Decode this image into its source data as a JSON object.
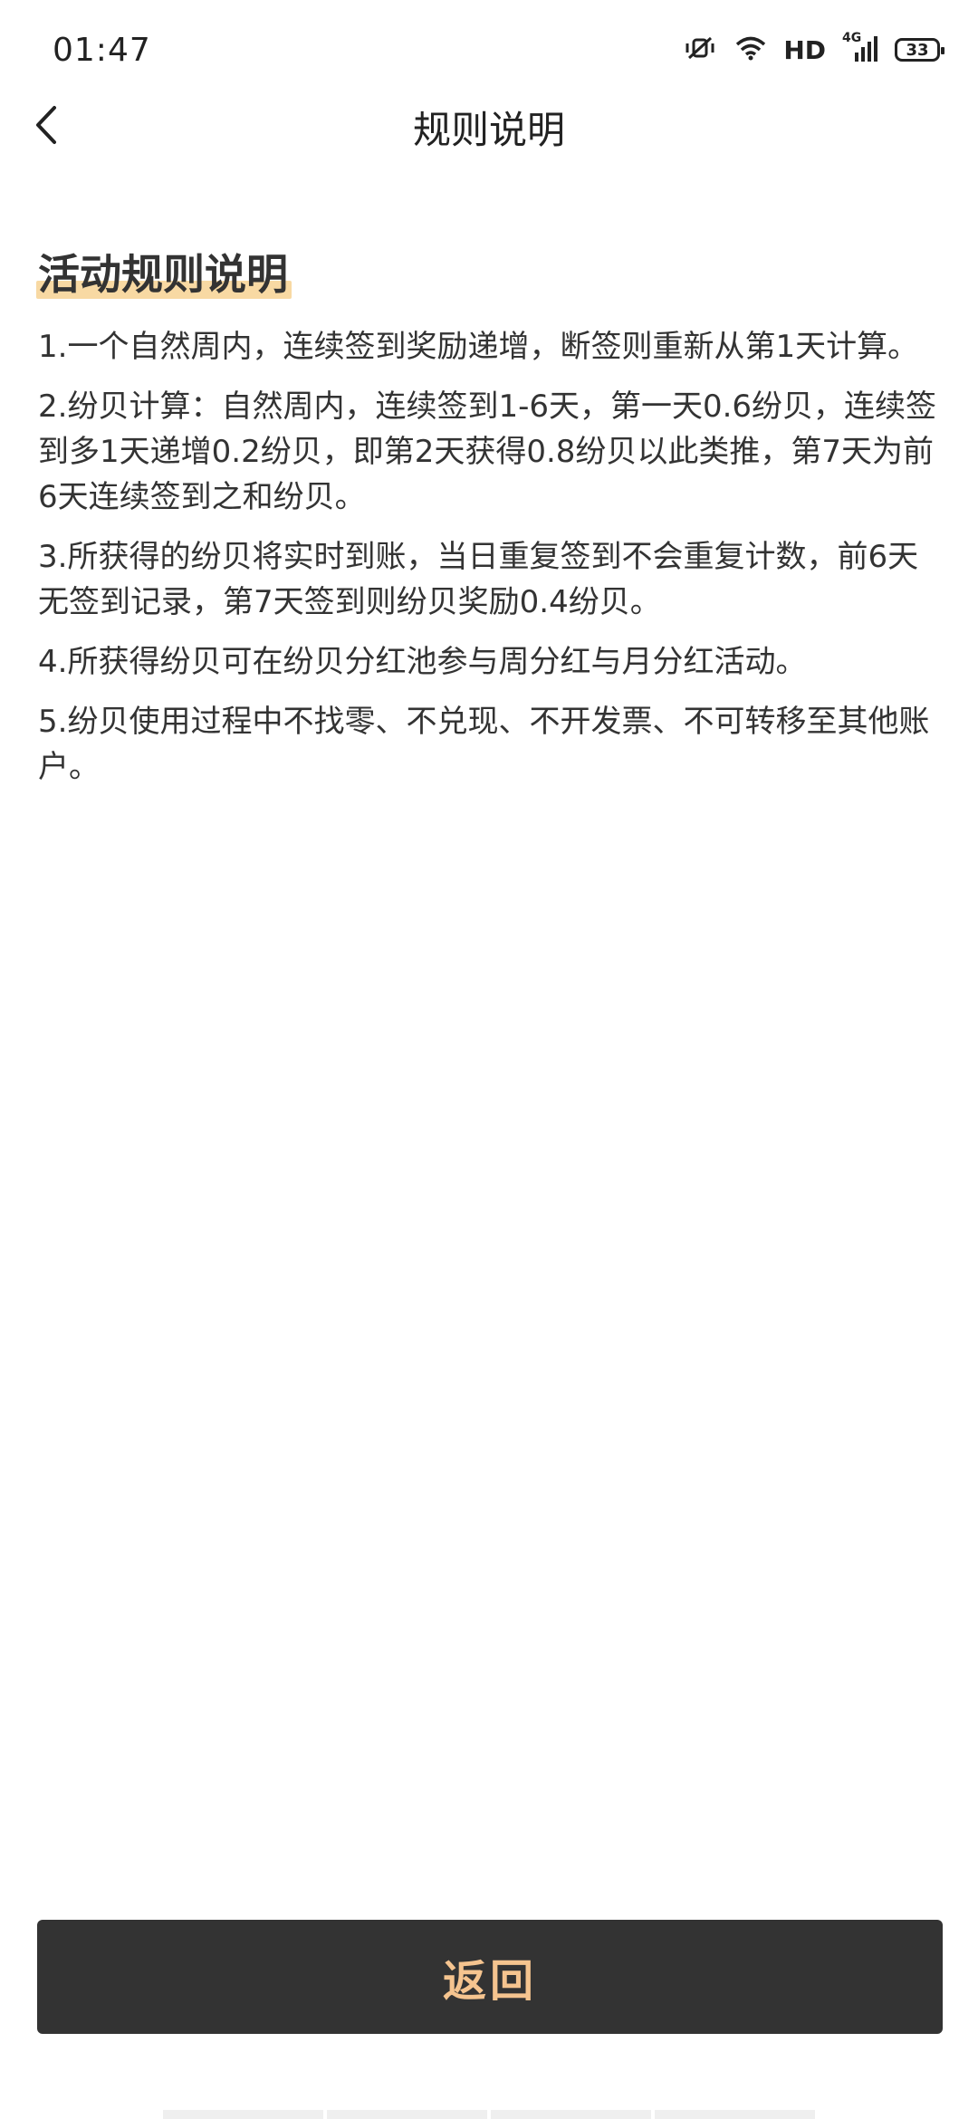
{
  "status_bar": {
    "time": "01:47",
    "hd_label": "HD",
    "network_label": "4G",
    "battery": "33",
    "icons": [
      "mute-vibrate-icon",
      "wifi-icon",
      "signal-icon",
      "battery-icon"
    ]
  },
  "header": {
    "title": "规则说明",
    "back_icon": "chevron-left-icon"
  },
  "content": {
    "section_title": "活动规则说明",
    "highlight_color": "#f8d9a3",
    "rules": [
      "1.一个自然周内，连续签到奖励递增，断签则重新从第1天计算。",
      "2.纷贝计算：自然周内，连续签到1-6天，第一天0.6纷贝，连续签到多1天递增0.2纷贝，即第2天获得0.8纷贝以此类推，第7天为前6天连续签到之和纷贝。",
      "3.所获得的纷贝将实时到账，当日重复签到不会重复计数，前6天无签到记录，第7天签到则纷贝奖励0.4纷贝。",
      "4.所获得纷贝可在纷贝分红池参与周分红与月分红活动。",
      "5.纷贝使用过程中不找零、不兑现、不开发票、不可转移至其他账户。"
    ]
  },
  "footer": {
    "return_label": "返回",
    "button_bg": "#333333",
    "button_text_color": "#f5c48f"
  }
}
